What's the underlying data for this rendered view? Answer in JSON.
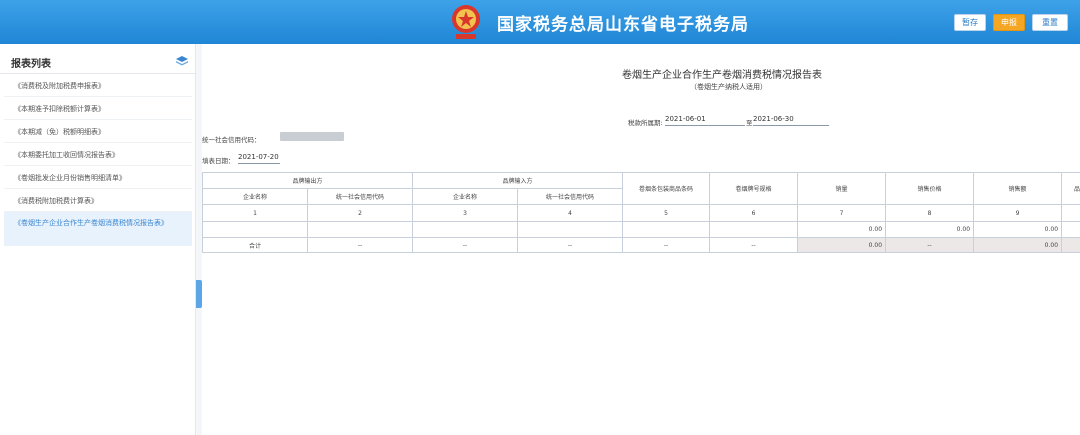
{
  "header": {
    "title": "国家税务总局山东省电子税务局",
    "buttons": {
      "save": "暂存",
      "declare": "申报",
      "reset": "重置"
    }
  },
  "sidebar": {
    "title": "报表列表",
    "items": [
      {
        "label": "《消费税及附加税费申报表》"
      },
      {
        "label": "《本期准予扣除税额计算表》"
      },
      {
        "label": "《本期减（免）税额明细表》"
      },
      {
        "label": "《本期委托加工收回情况报告表》"
      },
      {
        "label": "《卷烟批发企业月份销售明细清单》"
      },
      {
        "label": "《消费税附加税费计算表》"
      },
      {
        "label": "《卷烟生产企业合作生产卷烟消费税情况报告表》"
      }
    ]
  },
  "form": {
    "title": "卷烟生产企业合作生产卷烟消费税情况报告表",
    "subtitle": "（卷烟生产纳税人适用）",
    "period_label": "税款所属期:",
    "period_start": "2021-06-01",
    "period_to": "至",
    "period_end": "2021-06-30",
    "credit_code_label": "统一社会信用代码：",
    "fill_date_label": "填表日期：",
    "fill_date": "2021-07-20"
  },
  "table": {
    "group_headers": [
      "品牌输出方",
      "品牌输入方"
    ],
    "sub_headers": [
      "企业名称",
      "统一社会信用代码",
      "企业名称",
      "统一社会信用代码"
    ],
    "single_headers": [
      "卷烟条包装商品条码",
      "卷烟牌号规格",
      "销量",
      "销售价格",
      "销售额",
      "品"
    ],
    "col_index": [
      "1",
      "2",
      "3",
      "4",
      "5",
      "6",
      "7",
      "8",
      "9"
    ],
    "row1": {
      "sales_qty": "0.00",
      "sales_price": "0.00",
      "sales_amount": "0.00"
    },
    "total": {
      "label": "合计",
      "dash": "--",
      "sales_qty": "0.00",
      "sales_amount": "0.00"
    }
  },
  "colors": {
    "header_blue": "#1f86d6",
    "accent_orange": "#f5a623",
    "active_item_bg": "#e8f2fc"
  }
}
